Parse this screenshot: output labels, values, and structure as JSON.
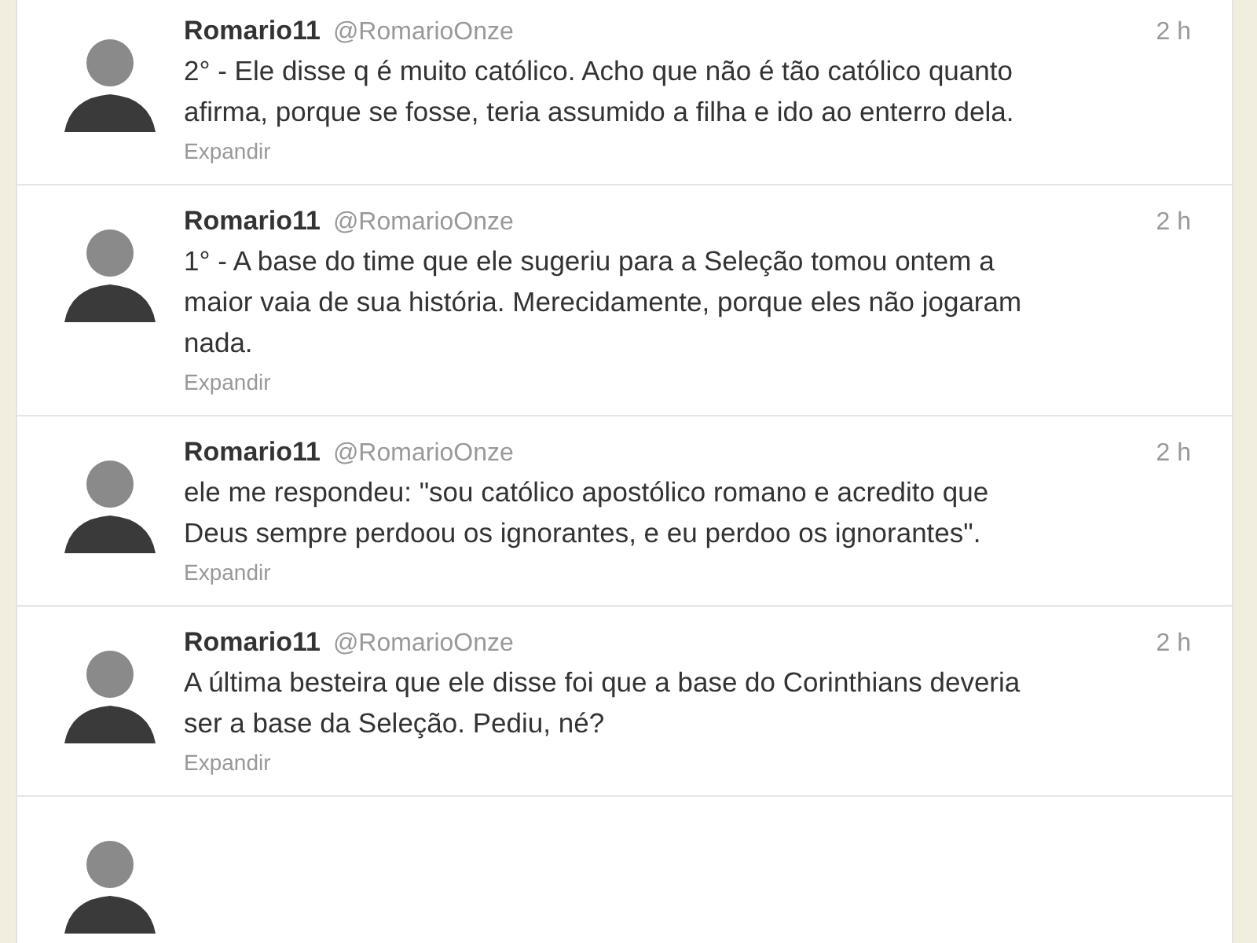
{
  "tweets": [
    {
      "name": "Romario11",
      "handle": "@RomarioOnze",
      "time": "2 h",
      "text": "2° - Ele disse q é muito católico. Acho que não é tão católico quanto\nafirma, porque se fosse, teria assumido a filha e ido ao enterro dela.",
      "action": "Expandir"
    },
    {
      "name": "Romario11",
      "handle": "@RomarioOnze",
      "time": "2 h",
      "text": "1° - A base do time que ele sugeriu para a Seleção tomou ontem a\nmaior vaia de sua história. Merecidamente, porque eles não jogaram\nnada.",
      "action": "Expandir"
    },
    {
      "name": "Romario11",
      "handle": "@RomarioOnze",
      "time": "2 h",
      "text": "ele me respondeu: \"sou católico apostólico romano e acredito que\nDeus sempre perdoou os ignorantes, e eu perdoo os ignorantes\".",
      "action": "Expandir"
    },
    {
      "name": "Romario11",
      "handle": "@RomarioOnze",
      "time": "2 h",
      "text": "A última besteira que ele disse foi que a base do Corinthians deveria\nser a base da Seleção. Pediu, né?",
      "action": "Expandir"
    }
  ]
}
